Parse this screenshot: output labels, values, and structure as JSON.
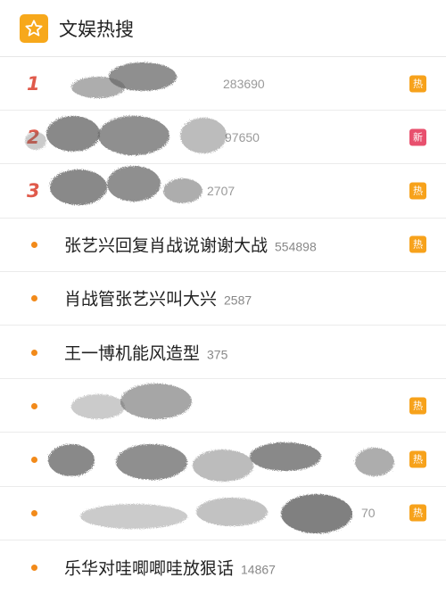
{
  "header": {
    "title": "文娱热搜",
    "icon": "star-icon",
    "icon_color": "#f7a81b"
  },
  "badges": {
    "hot": "热",
    "new": "新"
  },
  "colors": {
    "rank": "#e05a4b",
    "dot": "#f28a1a",
    "hot_badge": "#f7a21b",
    "new_badge": "#e8506e"
  },
  "items": [
    {
      "rank": "1",
      "label": "",
      "count": "283690",
      "badge": "热"
    },
    {
      "rank": "2",
      "label": "",
      "count": "97650",
      "badge": "新"
    },
    {
      "rank": "3",
      "label": "",
      "count": "2707",
      "badge": "热"
    },
    {
      "rank": "",
      "label": "张艺兴回复肖战说谢谢大战",
      "count": "554898",
      "badge": "热"
    },
    {
      "rank": "",
      "label": "肖战管张艺兴叫大兴",
      "count": "2587",
      "badge": ""
    },
    {
      "rank": "",
      "label": "王一博机能风造型",
      "count": "375",
      "badge": ""
    },
    {
      "rank": "",
      "label": "",
      "count": "",
      "badge": "热"
    },
    {
      "rank": "",
      "label": "",
      "count": "",
      "badge": "热"
    },
    {
      "rank": "",
      "label": "",
      "count": "70",
      "badge": "热"
    },
    {
      "rank": "",
      "label": "乐华对哇唧唧哇放狠话",
      "count": "14867",
      "badge": ""
    }
  ]
}
